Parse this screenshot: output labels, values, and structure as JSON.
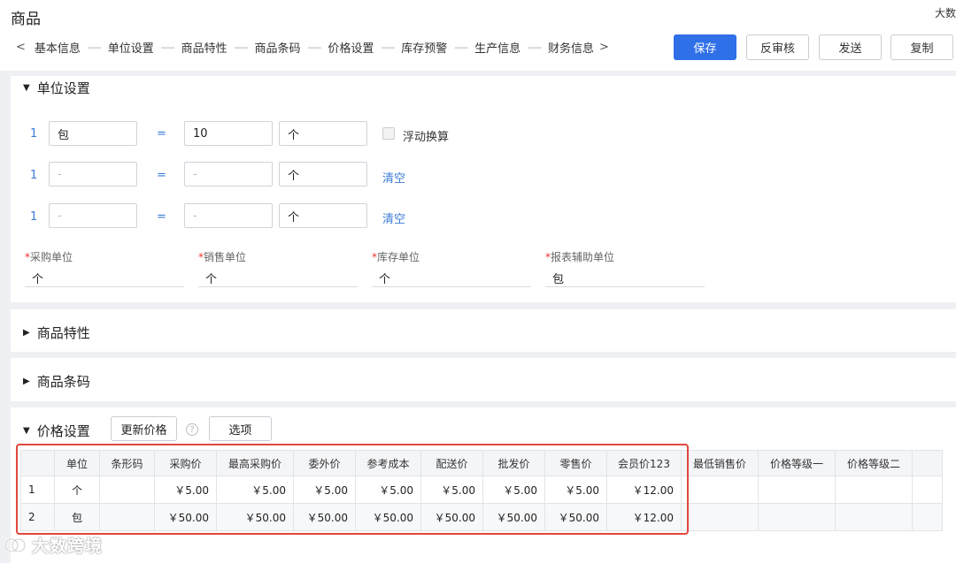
{
  "header": {
    "title": "商品",
    "top_right_hint": "大数",
    "nav_prev": "<",
    "nav_next": ">",
    "nav_steps": [
      "基本信息",
      "单位设置",
      "商品特性",
      "商品条码",
      "价格设置",
      "库存预警",
      "生产信息",
      "财务信息"
    ],
    "nav_separator": "-----",
    "buttons": {
      "save": "保存",
      "unapprove": "反审核",
      "send": "发送",
      "copy": "复制"
    }
  },
  "unit_section": {
    "title": "单位设置",
    "rows": [
      {
        "num": "1",
        "unit": "包",
        "eq": "=",
        "qty": "10",
        "base_unit": "个",
        "unit_placeholder": false,
        "qty_placeholder": false
      },
      {
        "num": "1",
        "unit": "-",
        "eq": "=",
        "qty": "-",
        "base_unit": "个",
        "unit_placeholder": true,
        "qty_placeholder": true
      },
      {
        "num": "1",
        "unit": "-",
        "eq": "=",
        "qty": "-",
        "base_unit": "个",
        "unit_placeholder": true,
        "qty_placeholder": true
      }
    ],
    "float_conversion_label": "浮动换算",
    "clear_label": "清空",
    "fields": [
      {
        "label": "采购单位",
        "value": "个"
      },
      {
        "label": "销售单位",
        "value": "个"
      },
      {
        "label": "库存单位",
        "value": "个"
      },
      {
        "label": "报表辅助单位",
        "value": "包"
      }
    ],
    "required_mark": "*"
  },
  "traits_section": {
    "title": "商品特性"
  },
  "barcode_section": {
    "title": "商品条码"
  },
  "price_section": {
    "title": "价格设置",
    "update_price_label": "更新价格",
    "help_icon_glyph": "?",
    "options_label": "选项",
    "columns": [
      "",
      "单位",
      "条形码",
      "采购价",
      "最高采购价",
      "委外价",
      "参考成本",
      "配送价",
      "批发价",
      "零售价",
      "会员价123",
      "最低销售价",
      "价格等级一",
      "价格等级二",
      ""
    ],
    "rows": [
      [
        "1",
        "个",
        "",
        "￥5.00",
        "￥5.00",
        "￥5.00",
        "￥5.00",
        "￥5.00",
        "￥5.00",
        "￥5.00",
        "￥12.00",
        "",
        "",
        "",
        ""
      ],
      [
        "2",
        "包",
        "",
        "￥50.00",
        "￥50.00",
        "￥50.00",
        "￥50.00",
        "￥50.00",
        "￥50.00",
        "￥50.00",
        "￥12.00",
        "",
        "",
        "",
        ""
      ]
    ]
  },
  "watermark": {
    "text": "大数跨境"
  },
  "colors": {
    "primary": "#2f6fe8",
    "link": "#3a7bd5",
    "highlight": "#e2463d",
    "required": "#e33"
  }
}
